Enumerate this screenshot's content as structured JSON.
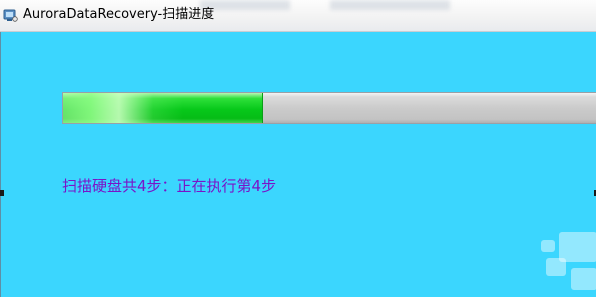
{
  "window": {
    "title": "AuroraDataRecovery-扫描进度",
    "icon": "app-icon",
    "background_color": "#3bd6fe"
  },
  "progress": {
    "value_fraction": 0.376,
    "fill_color": "#07c81a",
    "track_color": "#cbcbcb"
  },
  "status": {
    "text": "扫描硬盘共4步：正在执行第4步",
    "color": "#7a14c8"
  }
}
